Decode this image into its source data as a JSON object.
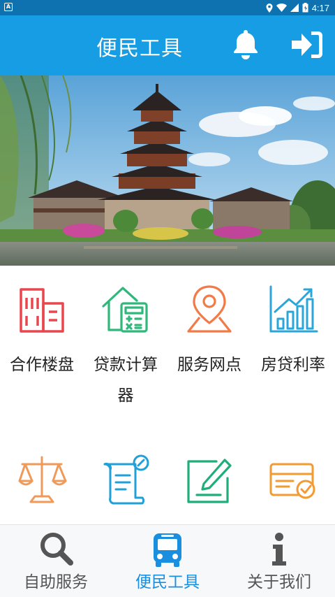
{
  "status_bar": {
    "time": "4:17",
    "left_icon": "A"
  },
  "header": {
    "title": "便民工具",
    "notification_icon": "bell-icon",
    "login_icon": "sign-in-icon"
  },
  "banner": {
    "subject": "pagoda-scenery-photo"
  },
  "tools": [
    {
      "label": "合作楼盘",
      "icon": "building-icon",
      "color": "#e8474e"
    },
    {
      "label": "贷款计算器",
      "icon": "house-calculator-icon",
      "color": "#2fb879"
    },
    {
      "label": "服务网点",
      "icon": "location-pin-icon",
      "color": "#f27a46"
    },
    {
      "label": "房贷利率",
      "icon": "bar-chart-trend-icon",
      "color": "#2aa6d8"
    },
    {
      "label": "",
      "icon": "scales-icon",
      "color": "#f09a5a"
    },
    {
      "label": "",
      "icon": "scroll-document-icon",
      "color": "#1fa0d8"
    },
    {
      "label": "",
      "icon": "edit-document-icon",
      "color": "#1fae7a"
    },
    {
      "label": "",
      "icon": "card-check-icon",
      "color": "#f39a30"
    }
  ],
  "bottom_nav": {
    "items": [
      {
        "label": "自助服务",
        "icon": "search-icon",
        "active": false
      },
      {
        "label": "便民工具",
        "icon": "bus-icon",
        "active": true
      },
      {
        "label": "关于我们",
        "icon": "info-icon",
        "active": false
      }
    ],
    "active_color": "#1a8fe0"
  }
}
